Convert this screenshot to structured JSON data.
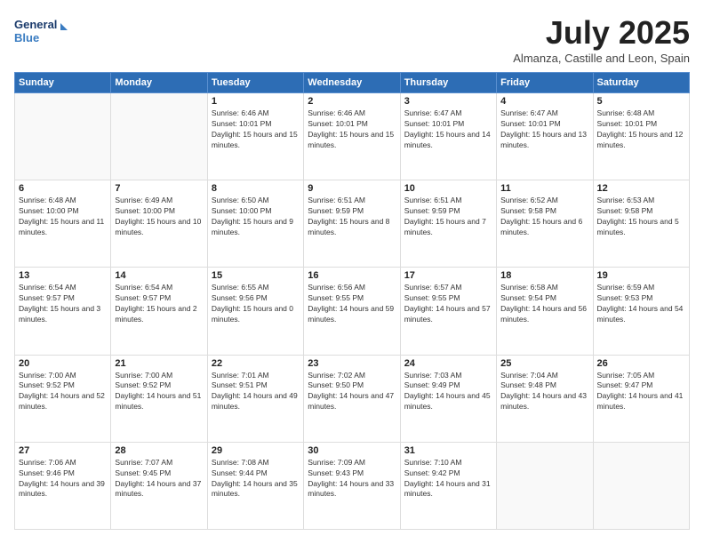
{
  "logo": {
    "line1": "General",
    "line2": "Blue"
  },
  "title": "July 2025",
  "subtitle": "Almanza, Castille and Leon, Spain",
  "days_header": [
    "Sunday",
    "Monday",
    "Tuesday",
    "Wednesday",
    "Thursday",
    "Friday",
    "Saturday"
  ],
  "weeks": [
    [
      {
        "day": "",
        "sunrise": "",
        "sunset": "",
        "daylight": ""
      },
      {
        "day": "",
        "sunrise": "",
        "sunset": "",
        "daylight": ""
      },
      {
        "day": "1",
        "sunrise": "Sunrise: 6:46 AM",
        "sunset": "Sunset: 10:01 PM",
        "daylight": "Daylight: 15 hours and 15 minutes."
      },
      {
        "day": "2",
        "sunrise": "Sunrise: 6:46 AM",
        "sunset": "Sunset: 10:01 PM",
        "daylight": "Daylight: 15 hours and 15 minutes."
      },
      {
        "day": "3",
        "sunrise": "Sunrise: 6:47 AM",
        "sunset": "Sunset: 10:01 PM",
        "daylight": "Daylight: 15 hours and 14 minutes."
      },
      {
        "day": "4",
        "sunrise": "Sunrise: 6:47 AM",
        "sunset": "Sunset: 10:01 PM",
        "daylight": "Daylight: 15 hours and 13 minutes."
      },
      {
        "day": "5",
        "sunrise": "Sunrise: 6:48 AM",
        "sunset": "Sunset: 10:01 PM",
        "daylight": "Daylight: 15 hours and 12 minutes."
      }
    ],
    [
      {
        "day": "6",
        "sunrise": "Sunrise: 6:48 AM",
        "sunset": "Sunset: 10:00 PM",
        "daylight": "Daylight: 15 hours and 11 minutes."
      },
      {
        "day": "7",
        "sunrise": "Sunrise: 6:49 AM",
        "sunset": "Sunset: 10:00 PM",
        "daylight": "Daylight: 15 hours and 10 minutes."
      },
      {
        "day": "8",
        "sunrise": "Sunrise: 6:50 AM",
        "sunset": "Sunset: 10:00 PM",
        "daylight": "Daylight: 15 hours and 9 minutes."
      },
      {
        "day": "9",
        "sunrise": "Sunrise: 6:51 AM",
        "sunset": "Sunset: 9:59 PM",
        "daylight": "Daylight: 15 hours and 8 minutes."
      },
      {
        "day": "10",
        "sunrise": "Sunrise: 6:51 AM",
        "sunset": "Sunset: 9:59 PM",
        "daylight": "Daylight: 15 hours and 7 minutes."
      },
      {
        "day": "11",
        "sunrise": "Sunrise: 6:52 AM",
        "sunset": "Sunset: 9:58 PM",
        "daylight": "Daylight: 15 hours and 6 minutes."
      },
      {
        "day": "12",
        "sunrise": "Sunrise: 6:53 AM",
        "sunset": "Sunset: 9:58 PM",
        "daylight": "Daylight: 15 hours and 5 minutes."
      }
    ],
    [
      {
        "day": "13",
        "sunrise": "Sunrise: 6:54 AM",
        "sunset": "Sunset: 9:57 PM",
        "daylight": "Daylight: 15 hours and 3 minutes."
      },
      {
        "day": "14",
        "sunrise": "Sunrise: 6:54 AM",
        "sunset": "Sunset: 9:57 PM",
        "daylight": "Daylight: 15 hours and 2 minutes."
      },
      {
        "day": "15",
        "sunrise": "Sunrise: 6:55 AM",
        "sunset": "Sunset: 9:56 PM",
        "daylight": "Daylight: 15 hours and 0 minutes."
      },
      {
        "day": "16",
        "sunrise": "Sunrise: 6:56 AM",
        "sunset": "Sunset: 9:55 PM",
        "daylight": "Daylight: 14 hours and 59 minutes."
      },
      {
        "day": "17",
        "sunrise": "Sunrise: 6:57 AM",
        "sunset": "Sunset: 9:55 PM",
        "daylight": "Daylight: 14 hours and 57 minutes."
      },
      {
        "day": "18",
        "sunrise": "Sunrise: 6:58 AM",
        "sunset": "Sunset: 9:54 PM",
        "daylight": "Daylight: 14 hours and 56 minutes."
      },
      {
        "day": "19",
        "sunrise": "Sunrise: 6:59 AM",
        "sunset": "Sunset: 9:53 PM",
        "daylight": "Daylight: 14 hours and 54 minutes."
      }
    ],
    [
      {
        "day": "20",
        "sunrise": "Sunrise: 7:00 AM",
        "sunset": "Sunset: 9:52 PM",
        "daylight": "Daylight: 14 hours and 52 minutes."
      },
      {
        "day": "21",
        "sunrise": "Sunrise: 7:00 AM",
        "sunset": "Sunset: 9:52 PM",
        "daylight": "Daylight: 14 hours and 51 minutes."
      },
      {
        "day": "22",
        "sunrise": "Sunrise: 7:01 AM",
        "sunset": "Sunset: 9:51 PM",
        "daylight": "Daylight: 14 hours and 49 minutes."
      },
      {
        "day": "23",
        "sunrise": "Sunrise: 7:02 AM",
        "sunset": "Sunset: 9:50 PM",
        "daylight": "Daylight: 14 hours and 47 minutes."
      },
      {
        "day": "24",
        "sunrise": "Sunrise: 7:03 AM",
        "sunset": "Sunset: 9:49 PM",
        "daylight": "Daylight: 14 hours and 45 minutes."
      },
      {
        "day": "25",
        "sunrise": "Sunrise: 7:04 AM",
        "sunset": "Sunset: 9:48 PM",
        "daylight": "Daylight: 14 hours and 43 minutes."
      },
      {
        "day": "26",
        "sunrise": "Sunrise: 7:05 AM",
        "sunset": "Sunset: 9:47 PM",
        "daylight": "Daylight: 14 hours and 41 minutes."
      }
    ],
    [
      {
        "day": "27",
        "sunrise": "Sunrise: 7:06 AM",
        "sunset": "Sunset: 9:46 PM",
        "daylight": "Daylight: 14 hours and 39 minutes."
      },
      {
        "day": "28",
        "sunrise": "Sunrise: 7:07 AM",
        "sunset": "Sunset: 9:45 PM",
        "daylight": "Daylight: 14 hours and 37 minutes."
      },
      {
        "day": "29",
        "sunrise": "Sunrise: 7:08 AM",
        "sunset": "Sunset: 9:44 PM",
        "daylight": "Daylight: 14 hours and 35 minutes."
      },
      {
        "day": "30",
        "sunrise": "Sunrise: 7:09 AM",
        "sunset": "Sunset: 9:43 PM",
        "daylight": "Daylight: 14 hours and 33 minutes."
      },
      {
        "day": "31",
        "sunrise": "Sunrise: 7:10 AM",
        "sunset": "Sunset: 9:42 PM",
        "daylight": "Daylight: 14 hours and 31 minutes."
      },
      {
        "day": "",
        "sunrise": "",
        "sunset": "",
        "daylight": ""
      },
      {
        "day": "",
        "sunrise": "",
        "sunset": "",
        "daylight": ""
      }
    ]
  ]
}
